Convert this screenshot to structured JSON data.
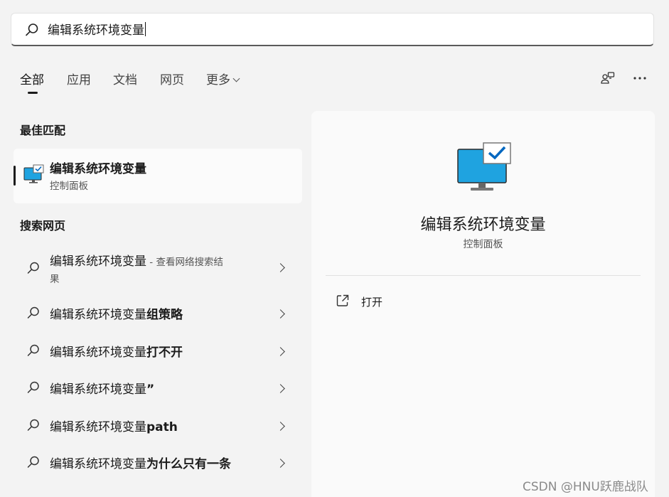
{
  "search": {
    "query": "编辑系统环境变量"
  },
  "tabs": [
    {
      "label": "全部",
      "active": true
    },
    {
      "label": "应用"
    },
    {
      "label": "文档"
    },
    {
      "label": "网页"
    },
    {
      "label": "更多"
    }
  ],
  "toolbar_icons": [
    "account-switch-icon",
    "more-options-icon"
  ],
  "best_match": {
    "section_title": "最佳匹配",
    "title": "编辑系统环境变量",
    "subtitle": "控制面板"
  },
  "web": {
    "section_title": "搜索网页",
    "items": [
      {
        "prefix": "编辑系统环境变量",
        "suffix": "",
        "desc": " - 查看网络搜索结",
        "desc2": "果"
      },
      {
        "prefix": "编辑系统环境变量",
        "suffix": "组策略"
      },
      {
        "prefix": "编辑系统环境变量",
        "suffix": "打不开"
      },
      {
        "prefix": "编辑系统环境变量",
        "suffix": "”"
      },
      {
        "prefix": "编辑系统环境变量",
        "suffix": "path"
      },
      {
        "prefix": "编辑系统环境变量",
        "suffix": "为什么只有一条"
      }
    ]
  },
  "preview": {
    "title": "编辑系统环境变量",
    "subtitle": "控制面板",
    "actions": [
      {
        "label": "打开",
        "icon": "open-external-icon"
      }
    ]
  },
  "watermark": "CSDN @HNU跃鹿战队",
  "colors": {
    "accent": "#0078d4",
    "monitor": "#1fa3e0"
  }
}
